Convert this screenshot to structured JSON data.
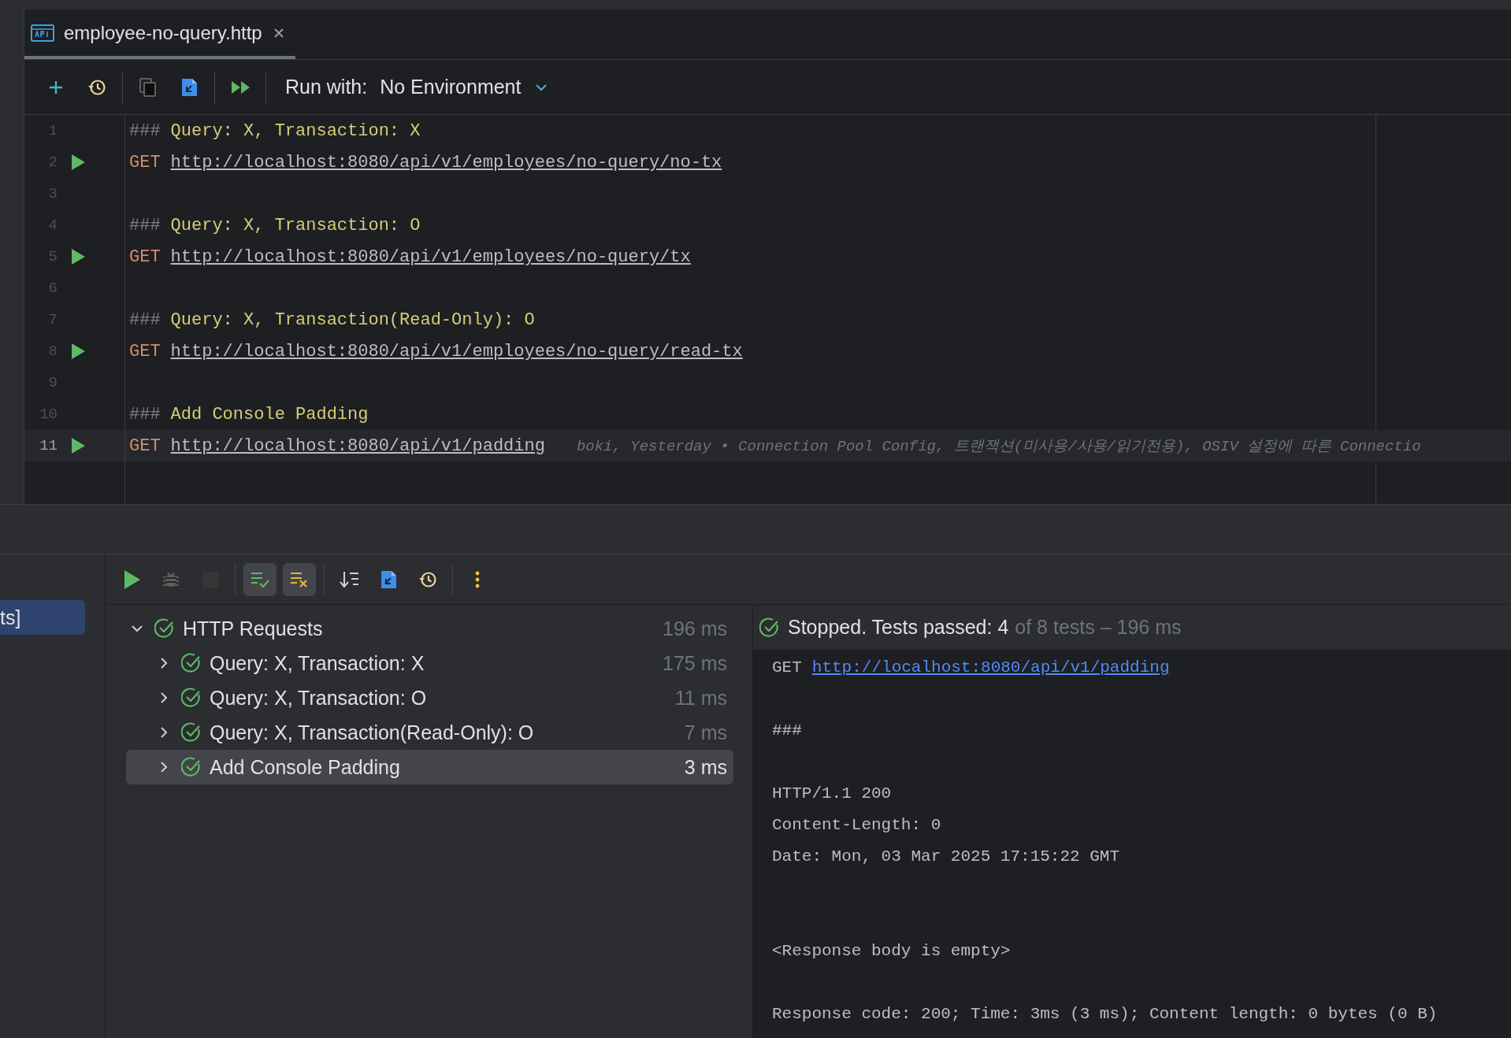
{
  "tab": {
    "title": "employee-no-query.http",
    "selected": true
  },
  "editor_toolbar": {
    "buttons": [
      {
        "kind": "add",
        "disabled": false
      },
      {
        "kind": "history",
        "disabled": false
      },
      {
        "kind": "separator"
      },
      {
        "kind": "copy",
        "disabled": true
      },
      {
        "kind": "export",
        "disabled": false
      },
      {
        "kind": "separator"
      },
      {
        "kind": "run-all",
        "disabled": false
      },
      {
        "kind": "separator"
      }
    ],
    "run_with_label": "Run with:",
    "environment": "No Environment"
  },
  "editor": {
    "lines": [
      {
        "number": "1",
        "kind": "separator",
        "marker": "###",
        "text": "Query: X, Transaction: X",
        "current": false
      },
      {
        "number": "2",
        "kind": "request",
        "method": "GET",
        "url": "http://localhost:8080/api/v1/employees/no-query/no-tx",
        "runnable": true,
        "current": false
      },
      {
        "number": "3",
        "kind": "blank",
        "current": false
      },
      {
        "number": "4",
        "kind": "separator",
        "marker": "###",
        "text": "Query: X, Transaction: O",
        "current": false
      },
      {
        "number": "5",
        "kind": "request",
        "method": "GET",
        "url": "http://localhost:8080/api/v1/employees/no-query/tx",
        "runnable": true,
        "current": false
      },
      {
        "number": "6",
        "kind": "blank",
        "current": false
      },
      {
        "number": "7",
        "kind": "separator",
        "marker": "###",
        "text": "Query: X, Transaction(Read-Only): O",
        "current": false
      },
      {
        "number": "8",
        "kind": "request",
        "method": "GET",
        "url": "http://localhost:8080/api/v1/employees/no-query/read-tx",
        "runnable": true,
        "current": false
      },
      {
        "number": "9",
        "kind": "blank",
        "current": false
      },
      {
        "number": "10",
        "kind": "separator",
        "marker": "###",
        "text": "Add Console Padding",
        "current": false
      },
      {
        "number": "11",
        "kind": "request",
        "method": "GET",
        "url": "http://localhost:8080/api/v1/padding",
        "runnable": true,
        "current": true,
        "blame": "boki, Yesterday • Connection Pool Config, 트랜잭션(미사용/사용/읽기전용), OSIV 설정에 따른 Connectio"
      }
    ]
  },
  "side_panel": {
    "items": [
      {
        "label": "ts]",
        "selected": true
      }
    ]
  },
  "run_toolbar": {
    "buttons": [
      {
        "kind": "run",
        "disabled": false,
        "on": false
      },
      {
        "kind": "debug",
        "disabled": true,
        "on": false
      },
      {
        "kind": "stop",
        "disabled": true,
        "on": false
      },
      {
        "kind": "separator"
      },
      {
        "kind": "show-passed",
        "disabled": false,
        "on": true
      },
      {
        "kind": "show-ignored",
        "disabled": false,
        "on": true
      },
      {
        "kind": "separator"
      },
      {
        "kind": "sort",
        "disabled": false,
        "on": false
      },
      {
        "kind": "export",
        "disabled": false,
        "on": false
      },
      {
        "kind": "history",
        "disabled": false,
        "on": false
      },
      {
        "kind": "separator"
      },
      {
        "kind": "more",
        "disabled": false,
        "on": false
      }
    ]
  },
  "test_tree": {
    "label": "HTTP Requests",
    "time": "196 ms",
    "expanded": true,
    "selected": false,
    "children": [
      {
        "label": "Query: X, Transaction: X",
        "time": "175 ms",
        "expanded": false,
        "selected": false
      },
      {
        "label": "Query: X, Transaction: O",
        "time": "11 ms",
        "expanded": false,
        "selected": false
      },
      {
        "label": "Query: X, Transaction(Read-Only): O",
        "time": "7 ms",
        "expanded": false,
        "selected": false
      },
      {
        "label": "Add Console Padding",
        "time": "3 ms",
        "expanded": false,
        "selected": true
      }
    ]
  },
  "console": {
    "summary": "Stopped. Tests passed: 4",
    "detail": "of 8 tests – 196 ms",
    "lines": [
      {
        "kind": "request",
        "method": "GET",
        "url": "http://localhost:8080/api/v1/padding"
      },
      {
        "kind": "blank"
      },
      {
        "kind": "text",
        "text": "###"
      },
      {
        "kind": "blank"
      },
      {
        "kind": "text",
        "text": "HTTP/1.1 200"
      },
      {
        "kind": "text",
        "text": "Content-Length: 0"
      },
      {
        "kind": "text",
        "text": "Date: Mon, 03 Mar 2025 17:15:22 GMT"
      },
      {
        "kind": "blank"
      },
      {
        "kind": "blank"
      },
      {
        "kind": "text",
        "text": "<Response body is empty>"
      },
      {
        "kind": "blank"
      },
      {
        "kind": "text",
        "text": "Response code: 200; Time: 3ms (3 ms); Content length: 0 bytes (0 B)"
      }
    ]
  }
}
